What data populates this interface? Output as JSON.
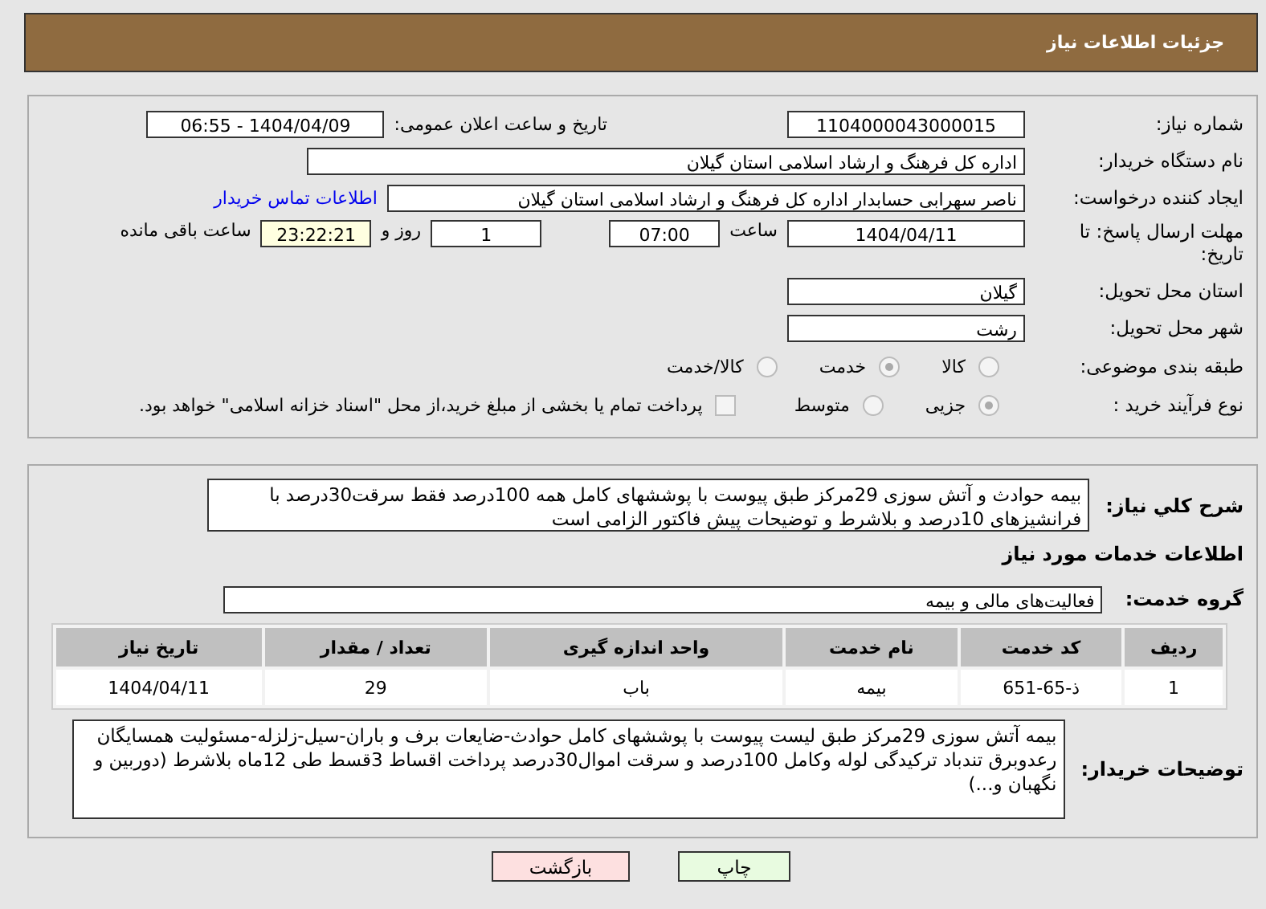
{
  "header": {
    "title": "جزئیات اطلاعات نیاز"
  },
  "details": {
    "need_number": {
      "label": "شماره نیاز:",
      "value": "1104000043000015"
    },
    "announce": {
      "label": "تاریخ و ساعت اعلان عمومی:",
      "value": "1404/04/09 - 06:55"
    },
    "buyer_org": {
      "label": "نام دستگاه خریدار:",
      "value": "اداره کل فرهنگ و ارشاد اسلامی استان گیلان"
    },
    "creator": {
      "label": "ایجاد کننده درخواست:",
      "value": "ناصر سهرابی حسابدار اداره کل فرهنگ و ارشاد اسلامی استان گیلان",
      "link": "اطلاعات تماس خریدار"
    },
    "deadline": {
      "label": "مهلت ارسال پاسخ: تا تاریخ:",
      "date": "1404/04/11",
      "time_label": "ساعت",
      "time": "07:00",
      "days": "1",
      "days_label": "روز و",
      "remaining": "23:22:21",
      "remaining_label": "ساعت باقی مانده"
    },
    "province": {
      "label": "استان محل تحویل:",
      "value": "گیلان"
    },
    "city": {
      "label": "شهر محل تحویل:",
      "value": "رشت"
    },
    "category": {
      "label": "طبقه بندی موضوعی:",
      "options": [
        {
          "label": "کالا",
          "selected": false
        },
        {
          "label": "خدمت",
          "selected": true
        },
        {
          "label": "کالا/خدمت",
          "selected": false
        }
      ]
    },
    "process": {
      "label": "نوع فرآیند خرید :",
      "options": [
        {
          "label": "جزیی",
          "selected": true
        },
        {
          "label": "متوسط",
          "selected": false
        }
      ],
      "payment": {
        "label": "پرداخت تمام یا بخشی از مبلغ خرید،از محل \"اسناد خزانه اسلامی\" خواهد بود.",
        "checked": false
      }
    }
  },
  "summary": {
    "label": "شرح کلي نياز:",
    "value": "بیمه حوادث و آتش سوزی 29مرکز طبق پیوست با پوششهای کامل همه 100درصد فقط سرقت30درصد با فرانشیزهای 10درصد و بلاشرط و توضیحات  پیش فاکتور الزامی است"
  },
  "services_heading": "اطلاعات خدمات مورد نیاز",
  "service_group": {
    "label": "گروه خدمت:",
    "value": "فعالیت‌های مالی و بیمه"
  },
  "table": {
    "columns": [
      "ردیف",
      "کد خدمت",
      "نام خدمت",
      "واحد اندازه گیری",
      "تعداد / مقدار",
      "تاریخ نیاز"
    ],
    "rows": [
      [
        "1",
        "ذ-65-651",
        "بیمه",
        "باب",
        "29",
        "1404/04/11"
      ]
    ]
  },
  "buyer_notes": {
    "label": "توضیحات خریدار:",
    "value": "بیمه آتش سوزی 29مرکز طبق لیست پیوست با پوششهای کامل حوادث-ضایعات برف و باران-سیل-زلزله-مسئولیت همسایگان رعدوبرق تندباد ترکیدگی لوله وکامل 100درصد و سرقت اموال30درصد پرداخت اقساط 3قسط طی 12ماه بلاشرط (دوربین و نگهبان و...)"
  },
  "buttons": [
    {
      "label": "چاپ",
      "kind": "print"
    },
    {
      "label": "بازگشت",
      "kind": "back"
    }
  ]
}
